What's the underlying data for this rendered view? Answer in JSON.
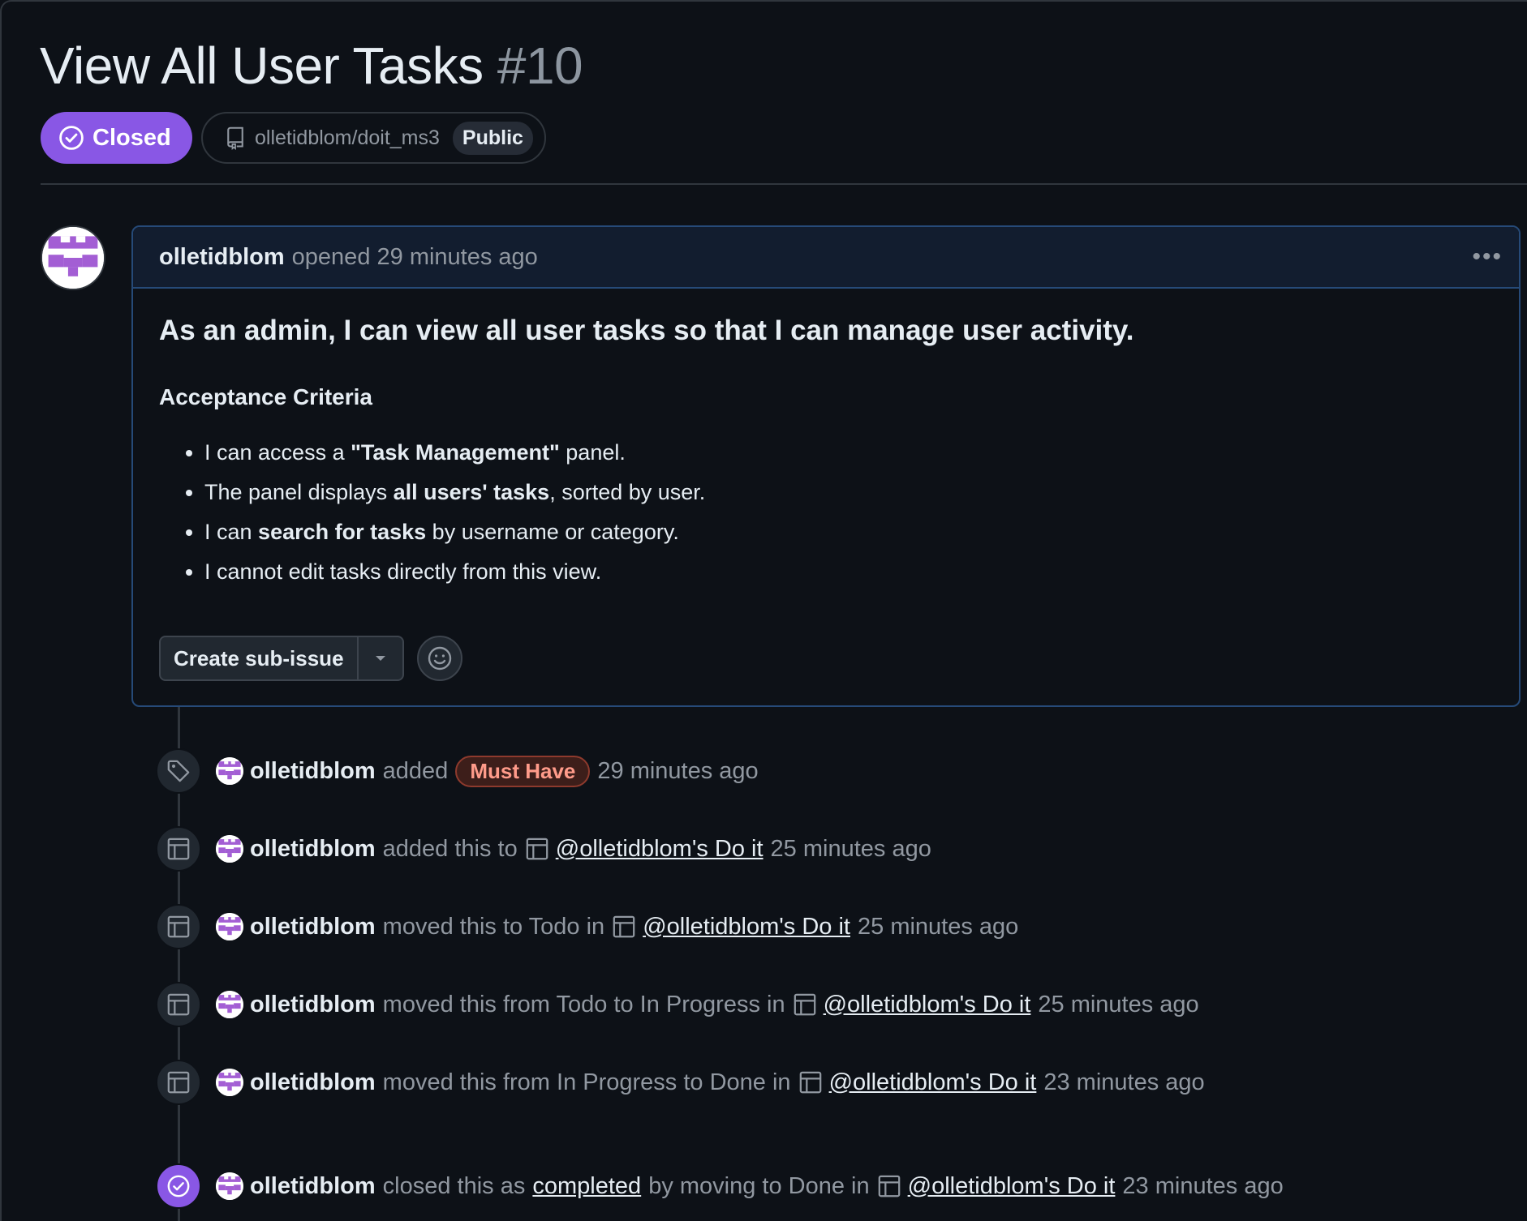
{
  "issue": {
    "title": "View All User Tasks",
    "number": "#10",
    "state": "Closed",
    "repo": "olletidblom/doit_ms3",
    "visibility": "Public"
  },
  "comment": {
    "author": "olletidblom",
    "meta": "opened 29 minutes ago",
    "heading": "As an admin, I can view all user tasks so that I can manage user activity.",
    "subheading": "Acceptance Criteria",
    "criteria": [
      {
        "pre": "I can access a ",
        "bold": "\"Task Management\"",
        "post": " panel."
      },
      {
        "pre": "The panel displays ",
        "bold": "all users' tasks",
        "post": ", sorted by user."
      },
      {
        "pre": "I can ",
        "bold": "search for tasks",
        "post": " by username or category."
      },
      {
        "pre": "I cannot edit tasks directly from this view.",
        "bold": "",
        "post": ""
      }
    ],
    "create_sub_issue": "Create sub-issue"
  },
  "timeline": [
    {
      "icon": "tag-icon",
      "author": "olletidblom",
      "text": "added",
      "label": "Must Have",
      "time": "29 minutes ago"
    },
    {
      "icon": "project-icon",
      "author": "olletidblom",
      "text": "added this to",
      "project": "@olletidblom's Do it",
      "time": "25 minutes ago"
    },
    {
      "icon": "project-icon",
      "author": "olletidblom",
      "text": "moved this to Todo in",
      "project": "@olletidblom's Do it",
      "time": "25 minutes ago"
    },
    {
      "icon": "project-icon",
      "author": "olletidblom",
      "text": "moved this from Todo to In Progress in",
      "project": "@olletidblom's Do it",
      "time": "25 minutes ago"
    },
    {
      "icon": "project-icon",
      "author": "olletidblom",
      "text": "moved this from In Progress to Done in",
      "project": "@olletidblom's Do it",
      "time": "23 minutes ago"
    },
    {
      "icon": "closed-check-icon",
      "author": "olletidblom",
      "text": "closed this as",
      "link": "completed",
      "text2": "by moving to Done in",
      "project": "@olletidblom's Do it",
      "time": "23 minutes ago"
    }
  ],
  "colors": {
    "background": "#0d1117",
    "closed_purple": "#8957e5",
    "label_red": "#ff9b8a"
  }
}
